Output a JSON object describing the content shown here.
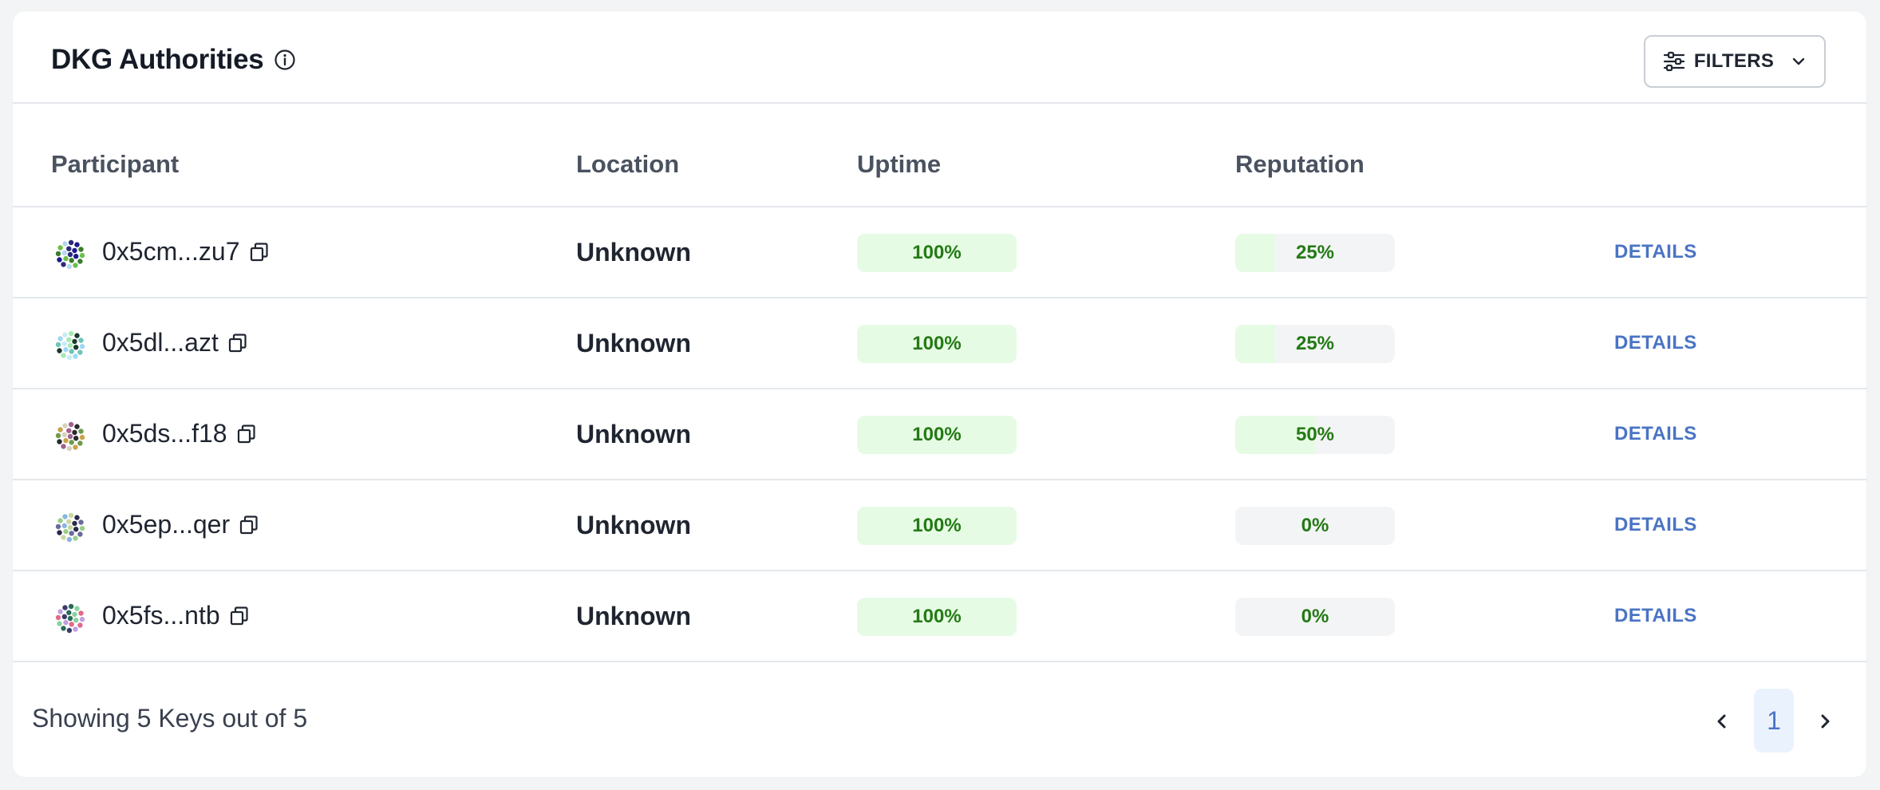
{
  "header": {
    "title": "DKG Authorities",
    "filters_label": "FILTERS"
  },
  "columns": {
    "participant": "Participant",
    "location": "Location",
    "uptime": "Uptime",
    "reputation": "Reputation"
  },
  "rows": [
    {
      "address": "0x5cm...zu7",
      "location": "Unknown",
      "uptime": "100%",
      "uptime_value": 1.0,
      "reputation": "25%",
      "reputation_value": 0.25,
      "details": "DETAILS",
      "avatar_colors": [
        "#2b2a7a",
        "#3a7d2e",
        "#b7d7f0",
        "#1a1a8c",
        "#6cc04a"
      ]
    },
    {
      "address": "0x5dl...azt",
      "location": "Unknown",
      "uptime": "100%",
      "uptime_value": 1.0,
      "reputation": "25%",
      "reputation_value": 0.25,
      "details": "DETAILS",
      "avatar_colors": [
        "#9fd8f5",
        "#a8e8b0",
        "#6fc4b8",
        "#c7ecf7",
        "#1a3a2a"
      ]
    },
    {
      "address": "0x5ds...f18",
      "location": "Unknown",
      "uptime": "100%",
      "uptime_value": 1.0,
      "reputation": "50%",
      "reputation_value": 0.5,
      "details": "DETAILS",
      "avatar_colors": [
        "#2a2a2a",
        "#c9a24a",
        "#a06090",
        "#6f9a4a",
        "#d7d0c0"
      ]
    },
    {
      "address": "0x5ep...qer",
      "location": "Unknown",
      "uptime": "100%",
      "uptime_value": 1.0,
      "reputation": "0%",
      "reputation_value": 0.0,
      "details": "DETAILS",
      "avatar_colors": [
        "#8ab5e0",
        "#2a2a4a",
        "#9ad08a",
        "#c8d8a0",
        "#6a6a9a"
      ]
    },
    {
      "address": "0x5fs...ntb",
      "location": "Unknown",
      "uptime": "100%",
      "uptime_value": 1.0,
      "reputation": "0%",
      "reputation_value": 0.0,
      "details": "DETAILS",
      "avatar_colors": [
        "#e06a8a",
        "#3a3a6a",
        "#8ad0a0",
        "#c0a0e0",
        "#2a6a5a"
      ]
    }
  ],
  "footer": {
    "summary": "Showing 5 Keys out of 5",
    "current_page": "1"
  },
  "icons": {
    "info": "info-icon",
    "filters": "sliders-icon",
    "dropdown": "chevron-down-icon",
    "copy": "copy-icon",
    "prev": "chevron-left-icon",
    "next": "chevron-right-icon"
  },
  "colors": {
    "accent_blue": "#4a74c4",
    "progress_green_bg": "#e6fbe4",
    "progress_green_text": "#237a14",
    "track_gray": "#f3f4f5"
  }
}
